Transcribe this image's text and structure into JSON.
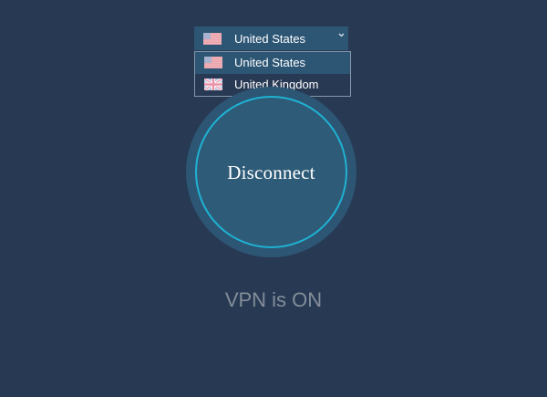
{
  "country_select": {
    "selected_label": "United States",
    "selected_flag": "us-flag-icon",
    "options": [
      {
        "label": "United States",
        "flag": "us-flag-icon",
        "highlighted": true
      },
      {
        "label": "United Kingdom",
        "flag": "uk-flag-icon",
        "highlighted": false
      }
    ]
  },
  "connect_button": {
    "label": "Disconnect"
  },
  "status": {
    "text": "VPN is ON"
  },
  "colors": {
    "background": "#283954",
    "circle_fill": "#2e5b78",
    "circle_ring": "#1fb2d3",
    "status_text": "#838d99",
    "highlight": "#2d5574"
  }
}
